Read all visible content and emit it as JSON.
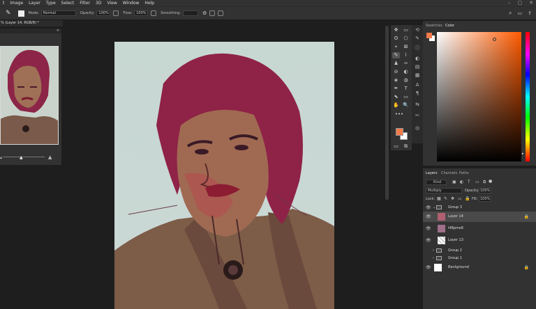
{
  "menubar": {
    "items": [
      "t",
      "Image",
      "Layer",
      "Type",
      "Select",
      "Filter",
      "3D",
      "View",
      "Window",
      "Help"
    ],
    "window_controls": [
      "–",
      "▢",
      "✕"
    ]
  },
  "options": {
    "mode_label": "Mode:",
    "mode_value": "Normal",
    "opacity_label": "Opacity:",
    "opacity_value": "100%",
    "flow_label": "Flow:",
    "flow_value": "100%",
    "smoothing_label": "Smoothing:",
    "right_icons": [
      "⌕",
      "▭",
      "⇪"
    ]
  },
  "document_tab": {
    "title": "% (Layer 14, RGB/8) *"
  },
  "tools": [
    "✥",
    "▭",
    "ʘ",
    "⬠",
    "⌖",
    "⊠",
    "✎",
    "⌇",
    "♟",
    "✑",
    "⊘",
    "◐",
    "◈",
    "◍",
    "✒",
    "T",
    "⬉",
    "▭",
    "✋",
    "🔍",
    "•••"
  ],
  "color_panel": {
    "tabs": [
      "Swatches",
      "Color"
    ],
    "foreground": "#f07a4a",
    "background": "#ffffff"
  },
  "layers_panel": {
    "tabs": [
      "Layers",
      "Channels",
      "Paths"
    ],
    "kind_label": "Kind",
    "blend_mode": "Multiply",
    "opacity_label": "Opacity:",
    "opacity_value": "100%",
    "lock_label": "Lock:",
    "fill_label": "Fill:",
    "fill_value": "100%",
    "layers": [
      {
        "name": "Group 3",
        "type": "group",
        "visible": true
      },
      {
        "name": "Layer 14",
        "type": "layer",
        "visible": true,
        "locked": true,
        "selected": true
      },
      {
        "name": "l48pme6",
        "type": "layer",
        "visible": true
      },
      {
        "name": "Layer 13",
        "type": "layer",
        "visible": true
      },
      {
        "name": "Group 2",
        "type": "group",
        "visible": false
      },
      {
        "name": "Group 1",
        "type": "group",
        "visible": false
      },
      {
        "name": "Background",
        "type": "layer",
        "visible": true,
        "locked": true
      }
    ]
  }
}
